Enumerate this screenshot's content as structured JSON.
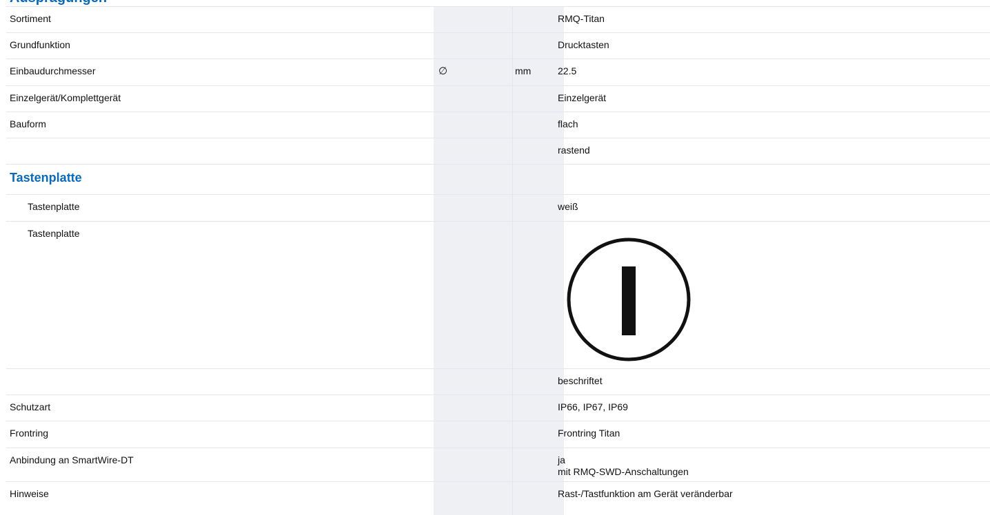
{
  "heading": "Ausprägungen",
  "rows": [
    {
      "label": "Sortiment",
      "value": "RMQ-Titan"
    },
    {
      "label": "Grundfunktion",
      "value": "Drucktasten"
    },
    {
      "label": "Einbaudurchmesser",
      "symbol": "∅",
      "unit": "mm",
      "value": "22.5"
    },
    {
      "label": "Einzelgerät/Komplettgerät",
      "value": "Einzelgerät"
    },
    {
      "label": "Bauform",
      "value": "flach"
    },
    {
      "label": "",
      "value": "rastend"
    },
    {
      "section": "Tastenplatte"
    },
    {
      "label": "Tastenplatte",
      "value": "weiß"
    },
    {
      "label": "Tastenplatte",
      "icon": "on-symbol-icon"
    },
    {
      "label": "",
      "value": "beschriftet"
    },
    {
      "label": "Schutzart",
      "value": "IP66, IP67, IP69"
    },
    {
      "label": "Frontring",
      "value": "Frontring Titan"
    },
    {
      "label": "Anbindung an SmartWire-DT",
      "value_lines": [
        "ja",
        "mit RMQ-SWD-Anschaltungen"
      ]
    },
    {
      "label": "Hinweise",
      "value": "Rast-/Tastfunktion am Gerät veränderbar"
    }
  ]
}
